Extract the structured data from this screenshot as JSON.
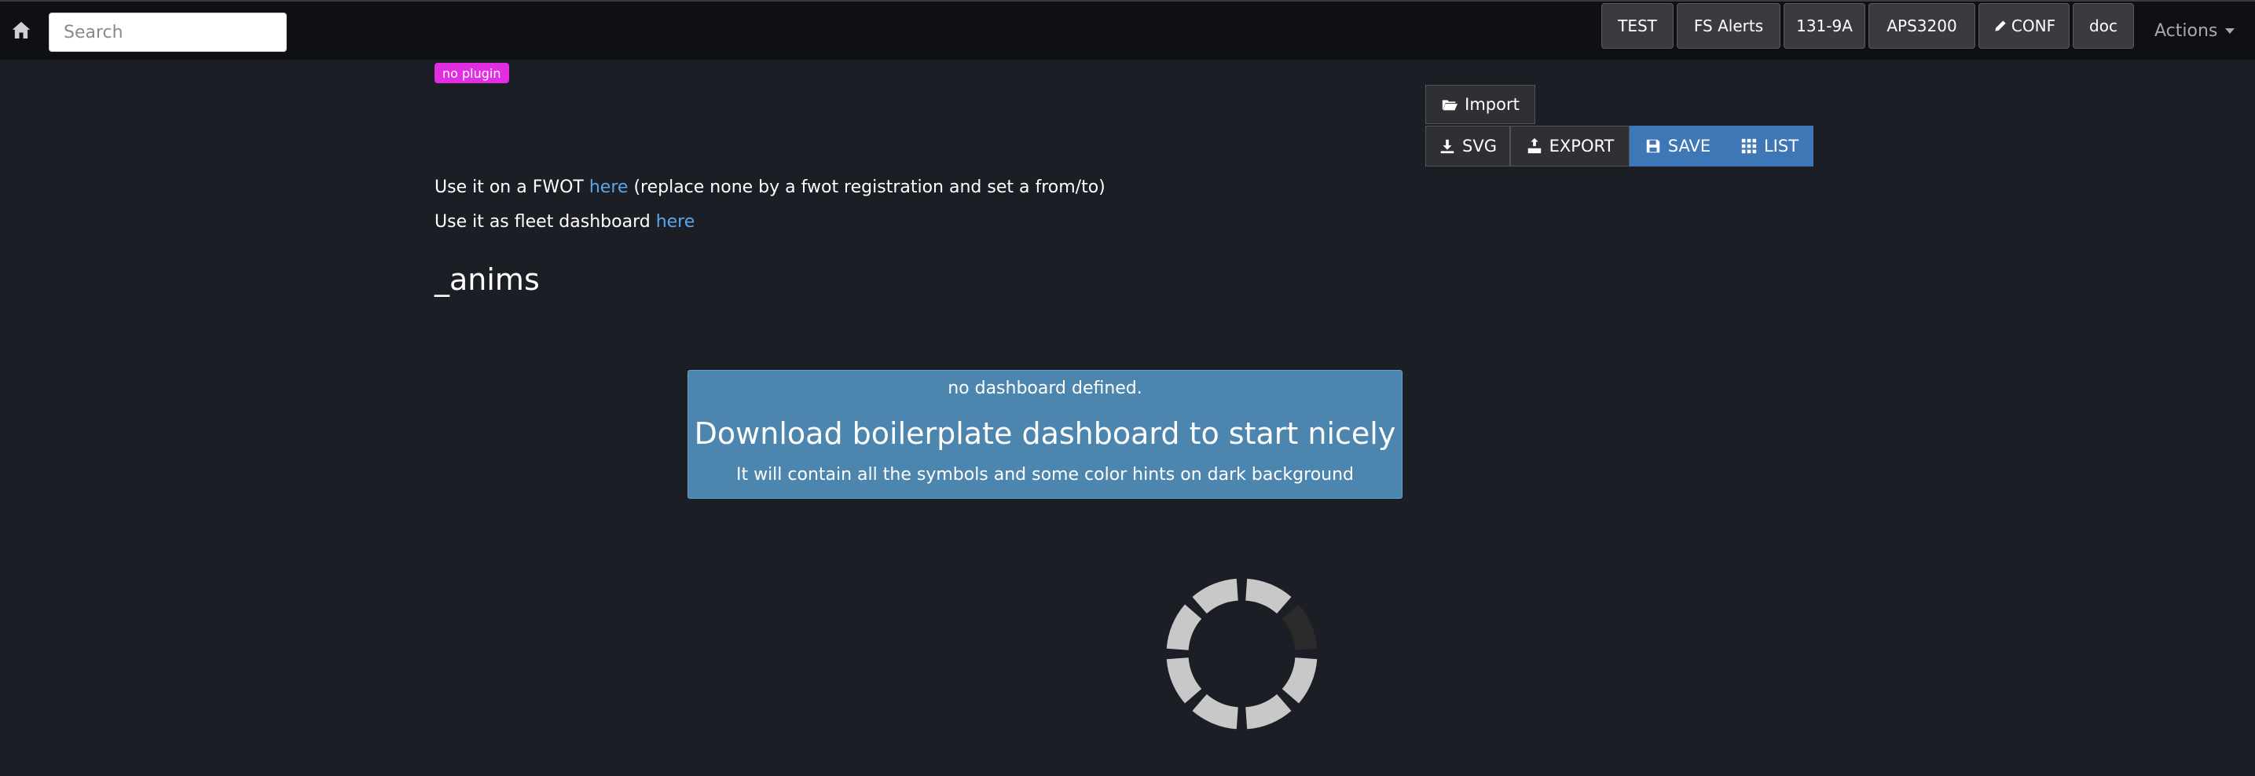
{
  "topbar": {
    "search": {
      "placeholder": "Search",
      "value": ""
    },
    "nav_buttons": [
      {
        "label": "TEST"
      },
      {
        "label": "FS Alerts"
      },
      {
        "label": "131-9A"
      },
      {
        "label": "APS3200"
      },
      {
        "label": "CONF",
        "icon": "pencil-icon"
      },
      {
        "label": "doc"
      }
    ],
    "actions_label": "Actions"
  },
  "badge": "no plugin",
  "toolbar": {
    "import_label": "Import",
    "svg_label": "SVG",
    "export_label": "EXPORT",
    "save_label": "SAVE",
    "list_label": "LIST"
  },
  "info": {
    "fwot_prefix": "Use it on a FWOT",
    "fwot_link": "here",
    "fwot_suffix": "(replace none by a fwot registration and set a from/to)",
    "fleet_prefix": "Use it as fleet dashboard",
    "fleet_link": "here"
  },
  "title": "_anims",
  "panel": {
    "line1": "no dashboard defined.",
    "line2": "Download boilerplate dashboard to start nicely",
    "line3": "It will contain all the symbols and some color hints on dark background"
  },
  "colors": {
    "background": "#1c1e26",
    "topbar": "#0f1014",
    "badge": "#e02ee0",
    "primary_button": "#3d77b6",
    "panel": "#4c86ae",
    "link": "#5aa6e8"
  }
}
